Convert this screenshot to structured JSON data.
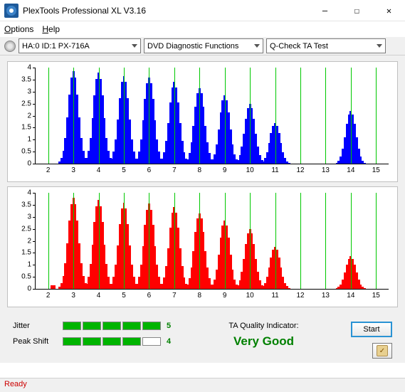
{
  "window": {
    "title": "PlexTools Professional XL V3.16"
  },
  "menu": {
    "options": "Options",
    "help": "Help"
  },
  "toolbar": {
    "device": "HA:0 ID:1   PX-716A",
    "category": "DVD Diagnostic Functions",
    "test": "Q-Check TA Test"
  },
  "chart_data": [
    {
      "type": "histogram",
      "color": "#0000ff",
      "yticks": [
        0,
        0.5,
        1,
        1.5,
        2,
        2.5,
        3,
        3.5,
        4
      ],
      "xticks": [
        2,
        3,
        4,
        5,
        6,
        7,
        8,
        9,
        10,
        11,
        12,
        13,
        14,
        15
      ],
      "ylim": [
        0,
        4
      ],
      "xlim": [
        1.5,
        15.5
      ],
      "peaks": [
        {
          "center": 3,
          "height": 3.85
        },
        {
          "center": 4,
          "height": 3.8
        },
        {
          "center": 5,
          "height": 3.65
        },
        {
          "center": 6,
          "height": 3.6
        },
        {
          "center": 7,
          "height": 3.4
        },
        {
          "center": 8,
          "height": 3.15
        },
        {
          "center": 9,
          "height": 2.85
        },
        {
          "center": 10,
          "height": 2.5
        },
        {
          "center": 11,
          "height": 1.7
        },
        {
          "center": 14,
          "height": 2.2
        }
      ],
      "vlines_at": [
        2,
        3,
        4,
        5,
        6,
        7,
        8,
        9,
        10,
        11,
        12,
        13,
        14,
        15
      ]
    },
    {
      "type": "histogram",
      "color": "#ff0000",
      "yticks": [
        0,
        0.5,
        1,
        1.5,
        2,
        2.5,
        3,
        3.5,
        4
      ],
      "xticks": [
        2,
        3,
        4,
        5,
        6,
        7,
        8,
        9,
        10,
        11,
        12,
        13,
        14,
        15
      ],
      "ylim": [
        0,
        4
      ],
      "xlim": [
        1.5,
        15.5
      ],
      "peaks": [
        {
          "center": 3,
          "height": 3.8
        },
        {
          "center": 4,
          "height": 3.7
        },
        {
          "center": 5,
          "height": 3.6
        },
        {
          "center": 6,
          "height": 3.55
        },
        {
          "center": 7,
          "height": 3.4
        },
        {
          "center": 8,
          "height": 3.15
        },
        {
          "center": 9,
          "height": 2.85
        },
        {
          "center": 10,
          "height": 2.5
        },
        {
          "center": 11,
          "height": 1.75
        },
        {
          "center": 14,
          "height": 1.35
        }
      ],
      "tiny_peaks": [
        {
          "center": 2.2,
          "height": 0.15
        }
      ],
      "vlines_at": [
        2,
        3,
        4,
        5,
        6,
        7,
        8,
        9,
        10,
        11,
        12,
        13,
        14,
        15
      ]
    }
  ],
  "meters": {
    "jitter": {
      "label": "Jitter",
      "value": 5,
      "max": 5
    },
    "peakshift": {
      "label": "Peak Shift",
      "value": 4,
      "max": 5
    }
  },
  "quality": {
    "label": "TA Quality Indicator:",
    "value": "Very Good"
  },
  "buttons": {
    "start": "Start"
  },
  "status": "Ready"
}
